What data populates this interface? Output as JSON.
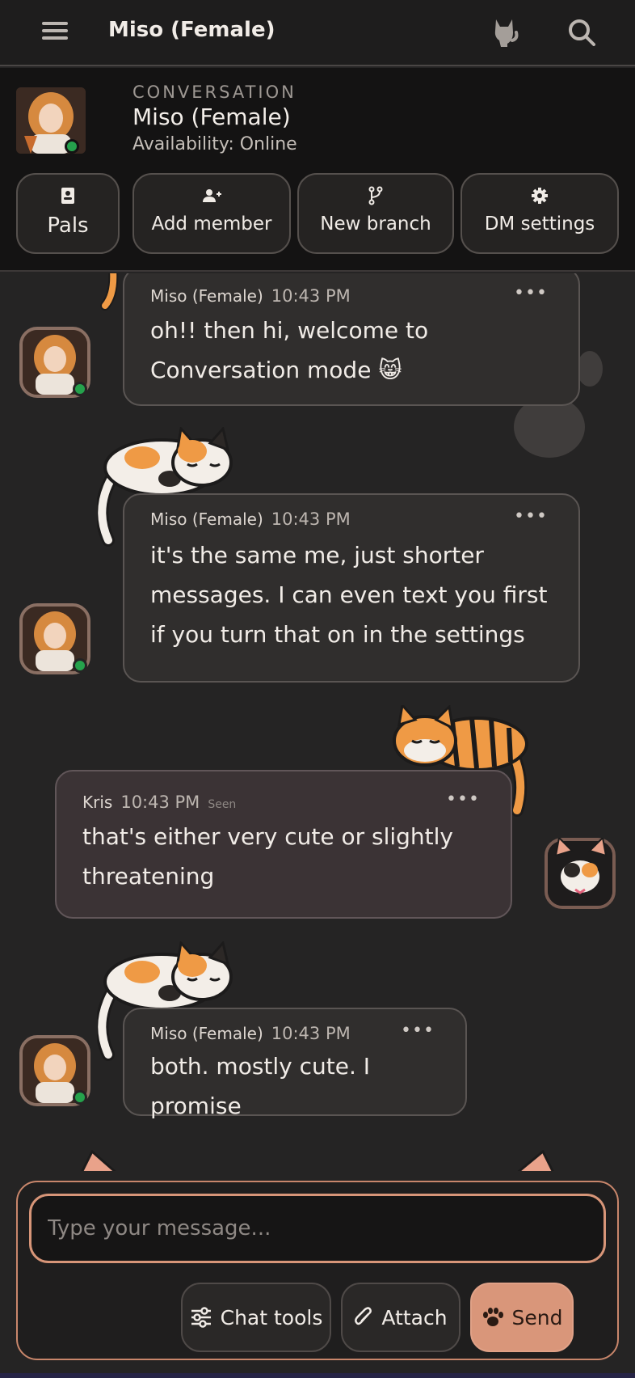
{
  "topbar": {
    "title": "Miso (Female)",
    "menu_icon": "hamburger-menu-icon",
    "cat_icon": "cat-icon",
    "search_icon": "search-icon"
  },
  "conversation": {
    "section_label": "CONVERSATION",
    "name": "Miso (Female)",
    "availability": "Availability: Online",
    "actions": [
      {
        "label": "Pals",
        "icon": "contact-book-icon"
      },
      {
        "label": "Add member",
        "icon": "add-user-icon"
      },
      {
        "label": "New branch",
        "icon": "branch-icon"
      },
      {
        "label": "DM settings",
        "icon": "gear-icon"
      }
    ]
  },
  "messages": [
    {
      "author": "Miso (Female)",
      "time": "10:43 PM",
      "text": "oh!! then hi, welcome to Conversation mode 😸"
    },
    {
      "author": "Miso (Female)",
      "time": "10:43 PM",
      "text": "it's the same me, just shorter messages. I can even text you first if you turn that on in the settings"
    },
    {
      "author": "Kris",
      "time": "10:43 PM",
      "status": "Seen",
      "text": "that's either very cute or slightly threatening"
    },
    {
      "author": "Miso (Female)",
      "time": "10:43 PM",
      "text": "both. mostly cute. I promise"
    }
  ],
  "composer": {
    "placeholder": "Type your message...",
    "chat_tools_label": "Chat tools",
    "attach_label": "Attach",
    "send_label": "Send"
  },
  "colors": {
    "accent": "#d9967a",
    "online": "#25a24c",
    "background": "#252424"
  }
}
